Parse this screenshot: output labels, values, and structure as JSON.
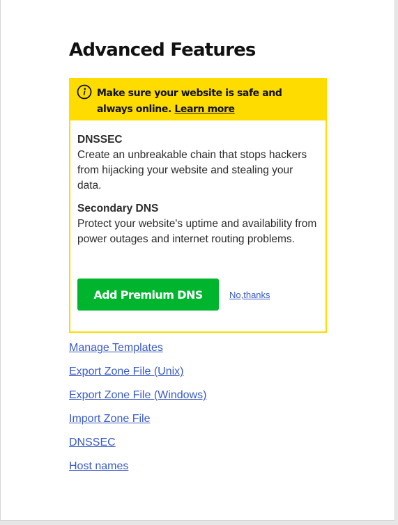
{
  "page": {
    "title": "Advanced Features"
  },
  "promo": {
    "banner_text": "Make sure your website is safe and always online.",
    "banner_link": "Learn more",
    "icon": "info-icon",
    "features": [
      {
        "title": "DNSSEC",
        "description": "Create an unbreakable chain that stops hackers from hijacking your website and stealing your data."
      },
      {
        "title": "Secondary DNS",
        "description": "Protect your website's uptime and availability from power outages and internet routing problems."
      }
    ],
    "primary_button": "Add Premium DNS",
    "decline_link": "No,thanks"
  },
  "links": [
    "Manage Templates",
    "Export Zone File (Unix)",
    "Export Zone File (Windows)",
    "Import Zone File",
    "DNSSEC",
    "Host names"
  ],
  "colors": {
    "banner_yellow": "#fedc00",
    "button_green": "#00b52e",
    "link_blue": "#3a5bc7"
  }
}
